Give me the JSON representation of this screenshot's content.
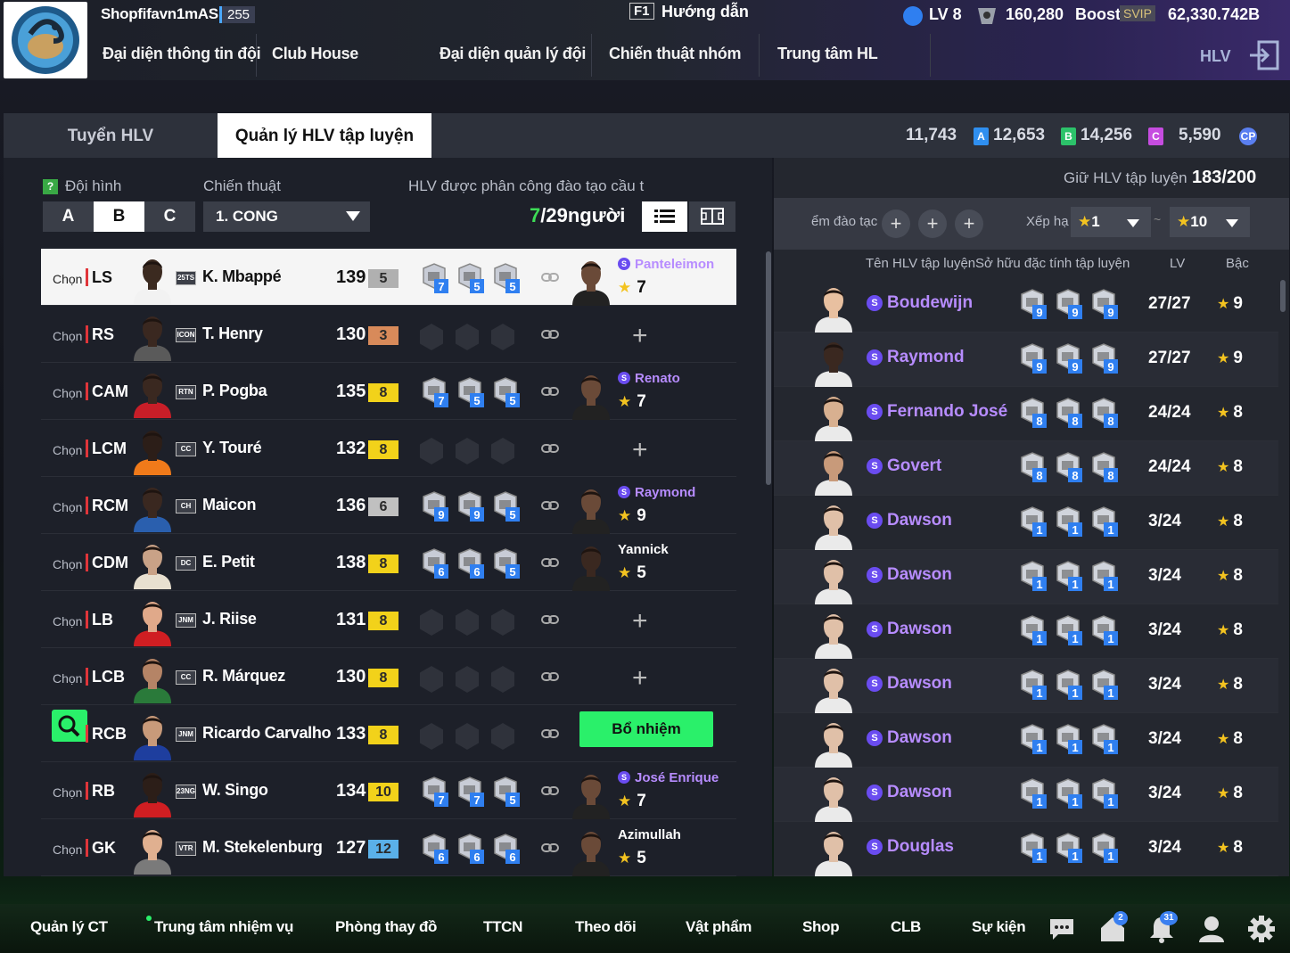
{
  "header": {
    "club_name": "Shopfifavn1mAS",
    "club_count": "255",
    "help_key": "F1",
    "help_label": "Hướng dẫn",
    "level": "LV 8",
    "coins": "160,280",
    "boost": "Boost",
    "svip": "SVIP",
    "bp": "62,330.742B",
    "coach_label": "HLV",
    "nav": [
      "Đại diện thông tin đội",
      "Club House",
      "Đại diện quản lý đội",
      "Chiến thuật nhóm",
      "Trung tâm HL"
    ]
  },
  "tabs": {
    "recruit": "Tuyển HLV",
    "manage": "Quản lý HLV tập luyện"
  },
  "currencies": [
    {
      "value": "11,743",
      "code": "A",
      "color": "#2f8ff0"
    },
    {
      "value": "12,653",
      "code": "B",
      "color": "#2cc26a"
    },
    {
      "value": "14,256",
      "code": "C",
      "color": "#c64ce0"
    },
    {
      "value": "5,590",
      "code": "CP",
      "color": "#5a7ff0"
    }
  ],
  "left": {
    "formation_label": "Đội hình",
    "tactic_label": "Chiến thuật",
    "assigned_label": "HLV được phân công đào tạo cầu t",
    "formations": [
      "A",
      "B",
      "C"
    ],
    "selected_formation": "B",
    "tactic_value": "1. CONG",
    "assigned_count": "7",
    "assigned_total": "/29người",
    "choose": "Chọn",
    "appoint": "Bổ nhiệm",
    "rows": [
      {
        "pos": "LS",
        "season": "25TS",
        "name": "K. Mbappé",
        "ovr": "139",
        "grade": "5",
        "grade_color": "#b0b0b0",
        "traits": [
          "7",
          "5",
          "5"
        ],
        "coach": "Panteleimon",
        "coach_s": true,
        "stars": "7",
        "skin": "#3b2a20",
        "shirt": "#f2f2f2"
      },
      {
        "pos": "RS",
        "season": "ICON",
        "name": "T. Henry",
        "ovr": "130",
        "grade": "3",
        "grade_color": "#d88a5a",
        "traits": [],
        "coach": null,
        "skin": "#3a2820",
        "shirt": "#5a5a5a"
      },
      {
        "pos": "CAM",
        "season": "RTN",
        "name": "P. Pogba",
        "ovr": "135",
        "grade": "8",
        "grade_color": "#f2d21a",
        "traits": [
          "7",
          "5",
          "5"
        ],
        "coach": "Renato",
        "coach_s": true,
        "stars": "7",
        "skin": "#3a2820",
        "shirt": "#c81e28"
      },
      {
        "pos": "LCM",
        "season": "CC",
        "name": "Y. Touré",
        "ovr": "132",
        "grade": "8",
        "grade_color": "#f2d21a",
        "traits": [],
        "coach": null,
        "skin": "#2c1e18",
        "shirt": "#f07a1a"
      },
      {
        "pos": "RCM",
        "season": "CH",
        "name": "Maicon",
        "ovr": "136",
        "grade": "6",
        "grade_color": "#c0c0c0",
        "traits": [
          "9",
          "9",
          "5"
        ],
        "coach": "Raymond",
        "coach_s": true,
        "stars": "9",
        "skin": "#3a2820",
        "shirt": "#2a5fae"
      },
      {
        "pos": "CDM",
        "season": "DC",
        "name": "E. Petit",
        "ovr": "138",
        "grade": "8",
        "grade_color": "#f2d21a",
        "traits": [
          "6",
          "6",
          "5"
        ],
        "coach": "Yannick",
        "coach_s": false,
        "stars": "5",
        "skin": "#c9a287",
        "shirt": "#e8e0d0"
      },
      {
        "pos": "LB",
        "season": "JNM",
        "name": "J. Riise",
        "ovr": "131",
        "grade": "8",
        "grade_color": "#f2d21a",
        "traits": [],
        "coach": null,
        "skin": "#e0a98a",
        "shirt": "#d01e22"
      },
      {
        "pos": "LCB",
        "season": "CC",
        "name": "R. Márquez",
        "ovr": "130",
        "grade": "8",
        "grade_color": "#f2d21a",
        "traits": [],
        "coach": null,
        "skin": "#b58466",
        "shirt": "#2a7a3a"
      },
      {
        "pos": "RCB",
        "season": "JNM",
        "name": "Ricardo Carvalho",
        "ovr": "133",
        "grade": "8",
        "grade_color": "#f2d21a",
        "traits": [],
        "coach": "appoint",
        "skin": "#c89a7a",
        "shirt": "#1e3e9e"
      },
      {
        "pos": "RB",
        "season": "23NG",
        "name": "W. Singo",
        "ovr": "134",
        "grade": "10",
        "grade_color": "#f2d21a",
        "traits": [
          "7",
          "7",
          "5"
        ],
        "coach": "José Enrique",
        "coach_s": true,
        "stars": "7",
        "skin": "#2c1e18",
        "shirt": "#d01e22"
      },
      {
        "pos": "GK",
        "season": "VTR",
        "name": "M. Stekelenburg",
        "ovr": "127",
        "grade": "12",
        "grade_color": "#5ab0e8",
        "traits": [
          "6",
          "6",
          "6"
        ],
        "coach": "Azimullah",
        "coach_s": false,
        "stars": "5",
        "skin": "#e0b090",
        "shirt": "#7a7a7a"
      }
    ]
  },
  "right": {
    "keep_label": "Giữ HLV tập luyện",
    "keep_value": "183/200",
    "filter_label": "ểm đào tạc",
    "sort_label": "Xếp hạ",
    "rank_from": "1",
    "rank_to": "10",
    "tilde": "~",
    "col_name": "Tên HLV tập luyện",
    "col_trait": "Sở hữu đặc tính tập luyện",
    "col_lv": "LV",
    "col_rank": "Bậc",
    "coaches": [
      {
        "name": "Boudewijn",
        "lv": "27/27",
        "rank": "9",
        "traits": [
          "9",
          "9",
          "9"
        ],
        "skin": "#e8c0a0"
      },
      {
        "name": "Raymond",
        "lv": "27/27",
        "rank": "9",
        "traits": [
          "9",
          "9",
          "9"
        ],
        "skin": "#3a2820"
      },
      {
        "name": "Fernando José",
        "lv": "24/24",
        "rank": "8",
        "traits": [
          "8",
          "8",
          "8"
        ],
        "skin": "#d8b090"
      },
      {
        "name": "Govert",
        "lv": "24/24",
        "rank": "8",
        "traits": [
          "8",
          "8",
          "8"
        ],
        "skin": "#c89a7a"
      },
      {
        "name": "Dawson",
        "lv": "3/24",
        "rank": "8",
        "traits": [
          "1",
          "1",
          "1"
        ],
        "skin": "#e0c0a8"
      },
      {
        "name": "Dawson",
        "lv": "3/24",
        "rank": "8",
        "traits": [
          "1",
          "1",
          "1"
        ],
        "skin": "#e0c0a8"
      },
      {
        "name": "Dawson",
        "lv": "3/24",
        "rank": "8",
        "traits": [
          "1",
          "1",
          "1"
        ],
        "skin": "#e0c0a8"
      },
      {
        "name": "Dawson",
        "lv": "3/24",
        "rank": "8",
        "traits": [
          "1",
          "1",
          "1"
        ],
        "skin": "#e0c0a8"
      },
      {
        "name": "Dawson",
        "lv": "3/24",
        "rank": "8",
        "traits": [
          "1",
          "1",
          "1"
        ],
        "skin": "#e0c0a8"
      },
      {
        "name": "Dawson",
        "lv": "3/24",
        "rank": "8",
        "traits": [
          "1",
          "1",
          "1"
        ],
        "skin": "#e0c0a8"
      },
      {
        "name": "Douglas",
        "lv": "3/24",
        "rank": "8",
        "traits": [
          "1",
          "1",
          "1"
        ],
        "skin": "#e0c0a8"
      }
    ]
  },
  "bottom": {
    "items": [
      "Quản lý CT",
      "Trung tâm nhiệm vụ",
      "Phòng thay đồ",
      "TTCN",
      "Theo dõi",
      "Vật phẩm",
      "Shop",
      "CLB",
      "Sự kiện"
    ],
    "home_badge": "2",
    "bell_badge": "31"
  }
}
